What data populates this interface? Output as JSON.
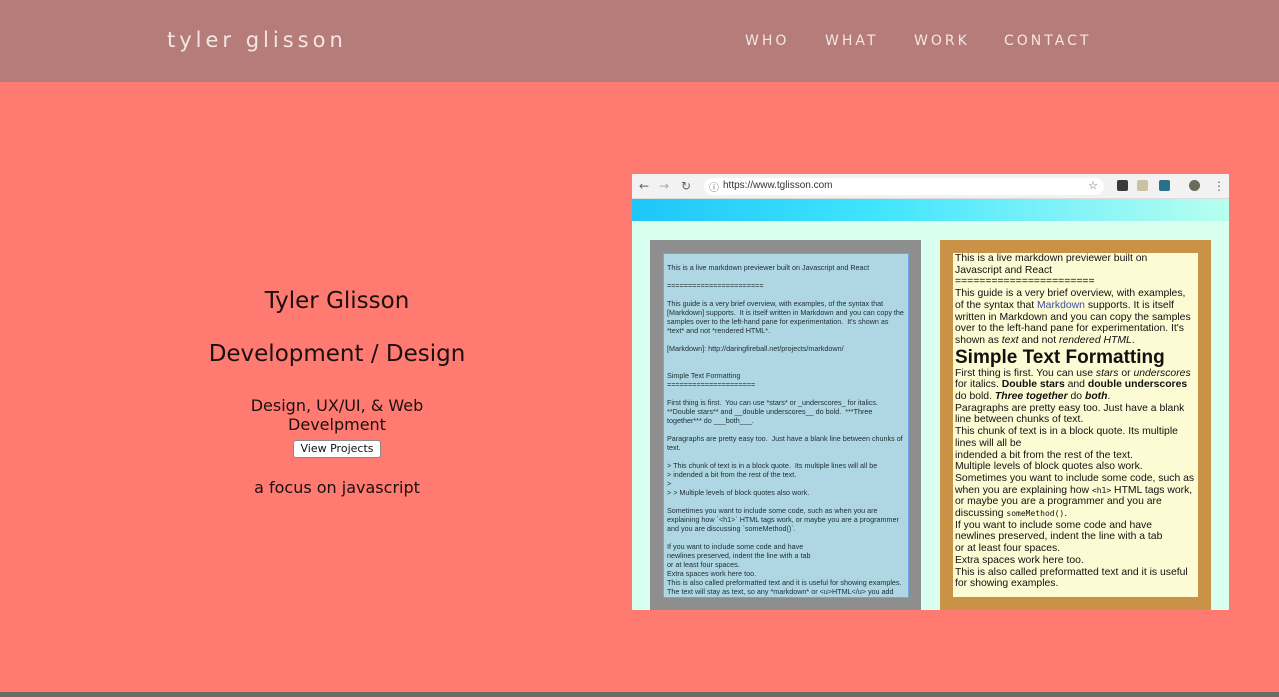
{
  "header": {
    "brand": "tyler glisson",
    "nav": [
      "WHO",
      "WHAT",
      "WORK",
      "CONTACT"
    ]
  },
  "hero": {
    "name": "Tyler Glisson",
    "role": "Development / Design",
    "skills": "Design, UX/UI, & Web Develpment",
    "button": "View Projects",
    "focus": "a focus on javascript"
  },
  "screenshot": {
    "url": "https://www.tglisson.com",
    "editor_text": "This is a live markdown previewer built on Javascript and React\n\n=======================\n\nThis guide is a very brief overview, with examples, of the syntax that [Markdown] supports.  It is itself written in Markdown and you can copy the samples over to the left-hand pane for experimentation.  It's shown as *text* and not *rendered HTML*.\n\n[Markdown]: http://daringfireball.net/projects/markdown/\n\n\nSimple Text Formatting\n=====================\n\nFirst thing is first.  You can use *stars* or _underscores_ for italics. **Double stars** and __double underscores__ do bold.  ***Three together*** do ___both___.\n\nParagraphs are pretty easy too.  Just have a blank line between chunks of text.\n\n> This chunk of text is in a block quote.  Its multiple lines will all be\n> indended a bit from the rest of the text.\n>\n> > Multiple levels of block quotes also work.\n\nSometimes you want to include some code, such as when you are explaining how `<h1>` HTML tags work, or maybe you are a programmer and you are discussing `someMethod()`.\n\nIf you want to include some code and have\nnewlines preserved, indent the line with a tab\nor at least four spaces.\nExtra spaces work here too.\nThis is also called preformatted text and it is useful for showing examples.\nThe text will stay as text, so any *markdown* or <u>HTML</u> you add will",
    "preview": {
      "intro_1": "This is a live markdown previewer built on Javascript and React",
      "rule": "=======================",
      "intro_2a": "This guide is a very brief overview, with examples, of the syntax that ",
      "intro_link": "Markdown",
      "intro_2b": " supports. It is itself written in Markdown and you can copy the samples over to the left-hand pane for experimentation. It's shown as ",
      "intro_em1": "text",
      "intro_2c": " and not ",
      "intro_em2": "rendered HTML",
      "intro_2d": ".",
      "heading": "Simple Text Formatting",
      "p1a": "First thing is first. You can use ",
      "p1_em1": "stars",
      "p1b": " or ",
      "p1_em2": "underscores",
      "p1c": " for italics. ",
      "p1_b1": "Double stars",
      "p1d": " and ",
      "p1_b2": "double underscores",
      "p1e": " do bold. ",
      "p1_bi": "Three together",
      "p1f": " do ",
      "p1_bi2": "both",
      "p1g": ".",
      "p2": "Paragraphs are pretty easy too. Just have a blank line between chunks of text.",
      "p3a": "This chunk of text is in a block quote. Its multiple lines will all be",
      "p3b": "indended a bit from the rest of the text.",
      "p3c": "Multiple levels of block quotes also work.",
      "p4a": "Sometimes you want to include some code, such as when you are explaining how ",
      "p4_code1": "<h1>",
      "p4b": " HTML tags work, or maybe you are a programmer and you are discussing ",
      "p4_code2": "someMethod()",
      "p4c": ".",
      "p5": "If you want to include some code and have",
      "p6": "newlines preserved, indent the line with a tab",
      "p7": "or at least four spaces.",
      "p8": "Extra spaces work here too.",
      "p9": "This is also called preformatted text and it is useful for showing examples."
    }
  },
  "colors": {
    "page_bg": "#ff7a70",
    "header_bg": "#b57c79",
    "editor_frame": "#8e8e8e",
    "preview_frame": "#c99247"
  },
  "icons": [
    "back-arrow-icon",
    "forward-arrow-icon",
    "reload-icon",
    "info-icon",
    "star-icon",
    "extension-icon",
    "profile-avatar-icon",
    "menu-dots-icon"
  ]
}
